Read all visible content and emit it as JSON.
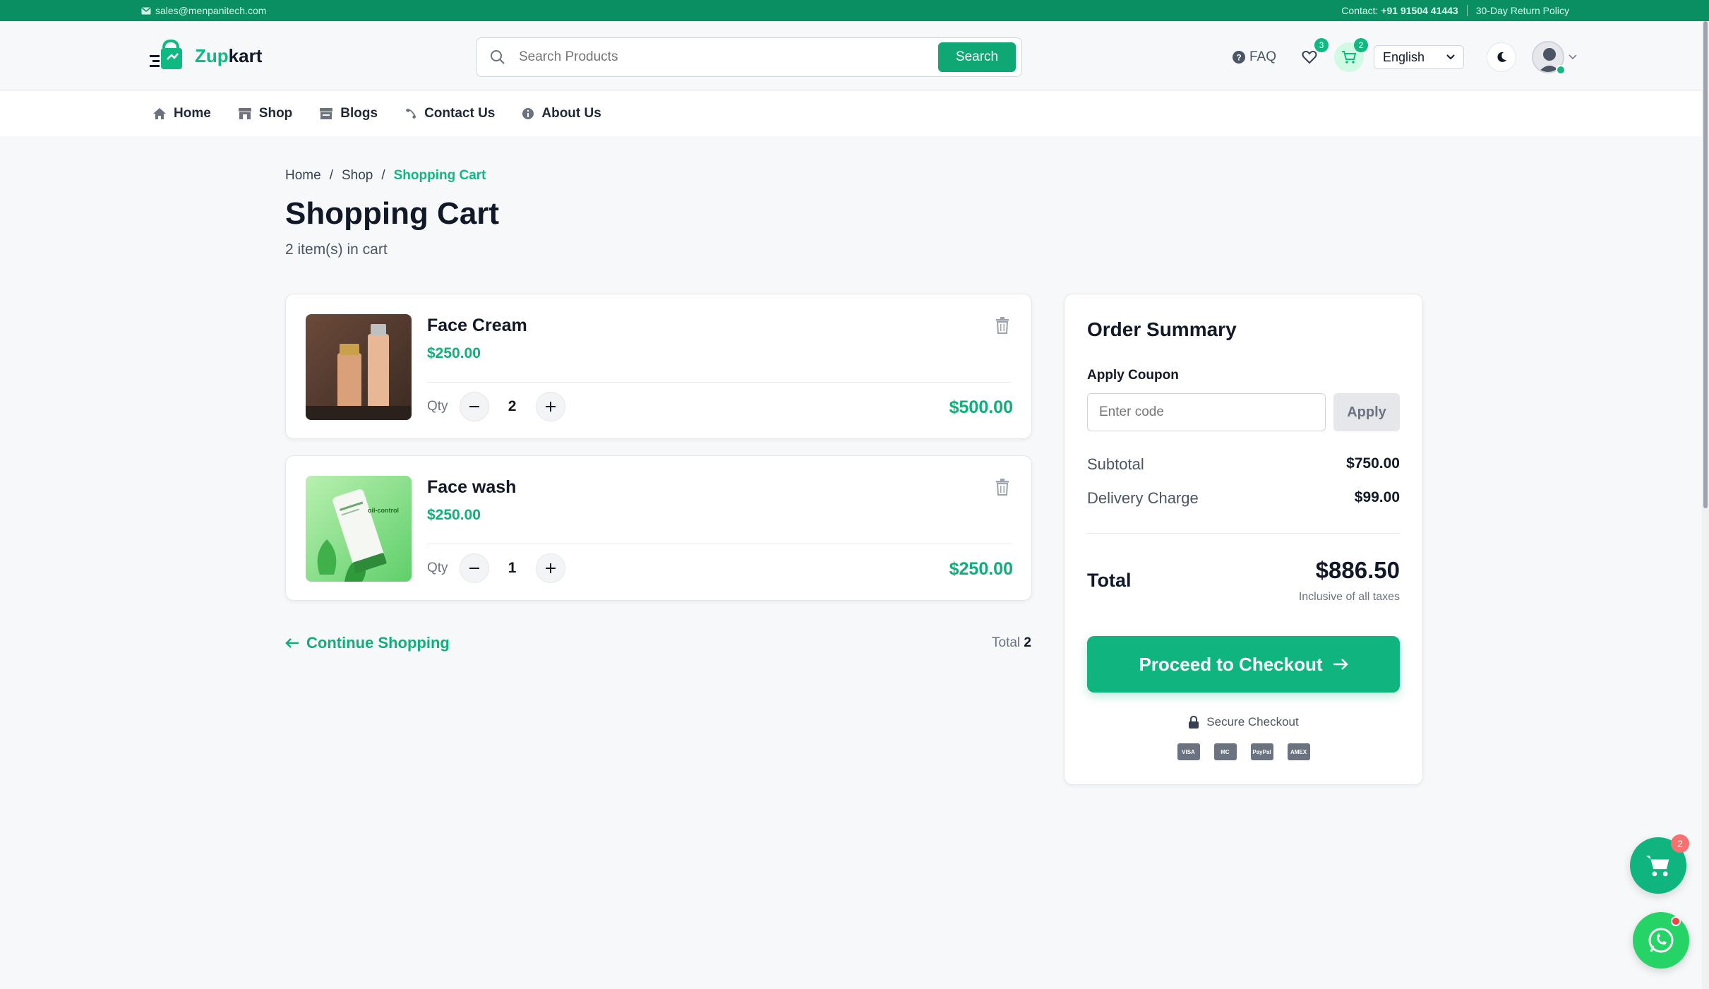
{
  "topbar": {
    "email": "sales@menpanitech.com",
    "contact_label": "Contact:",
    "contact_number": "+91 91504 41443",
    "policy": "30-Day Return Policy"
  },
  "header": {
    "brand_prefix": "Zup",
    "brand_suffix": "kart",
    "search_placeholder": "Search Products",
    "search_button": "Search",
    "faq_label": "FAQ",
    "wishlist_count": "3",
    "cart_count": "2",
    "language": "English"
  },
  "nav": {
    "items": [
      {
        "label": "Home",
        "icon": "home-icon"
      },
      {
        "label": "Shop",
        "icon": "store-icon"
      },
      {
        "label": "Blogs",
        "icon": "blog-icon"
      },
      {
        "label": "Contact Us",
        "icon": "phone-icon"
      },
      {
        "label": "About Us",
        "icon": "info-icon"
      }
    ]
  },
  "breadcrumb": {
    "home": "Home",
    "shop": "Shop",
    "current": "Shopping Cart",
    "sep": "/"
  },
  "page": {
    "title": "Shopping Cart",
    "subtitle": "2 item(s) in cart"
  },
  "cart": {
    "qty_label": "Qty",
    "items": [
      {
        "name": "Face Cream",
        "price": "$250.00",
        "qty": "2",
        "total": "$500.00"
      },
      {
        "name": "Face wash",
        "price": "$250.00",
        "qty": "1",
        "total": "$250.00"
      }
    ],
    "continue_label": "Continue Shopping",
    "total_label": "Total",
    "total_count": "2"
  },
  "summary": {
    "title": "Order Summary",
    "coupon_label": "Apply Coupon",
    "coupon_placeholder": "Enter code",
    "apply_label": "Apply",
    "subtotal_label": "Subtotal",
    "subtotal_value": "$750.00",
    "delivery_label": "Delivery Charge",
    "delivery_value": "$99.00",
    "total_label": "Total",
    "total_value": "$886.50",
    "taxes_note": "Inclusive of all taxes",
    "checkout_label": "Proceed to Checkout",
    "secure_label": "Secure Checkout",
    "payment_methods": [
      "VISA",
      "MC",
      "PayPal",
      "AMEX"
    ]
  },
  "floating": {
    "cart_badge": "2"
  },
  "colors": {
    "brand": "#10b981",
    "topbar": "#0a8f63"
  }
}
